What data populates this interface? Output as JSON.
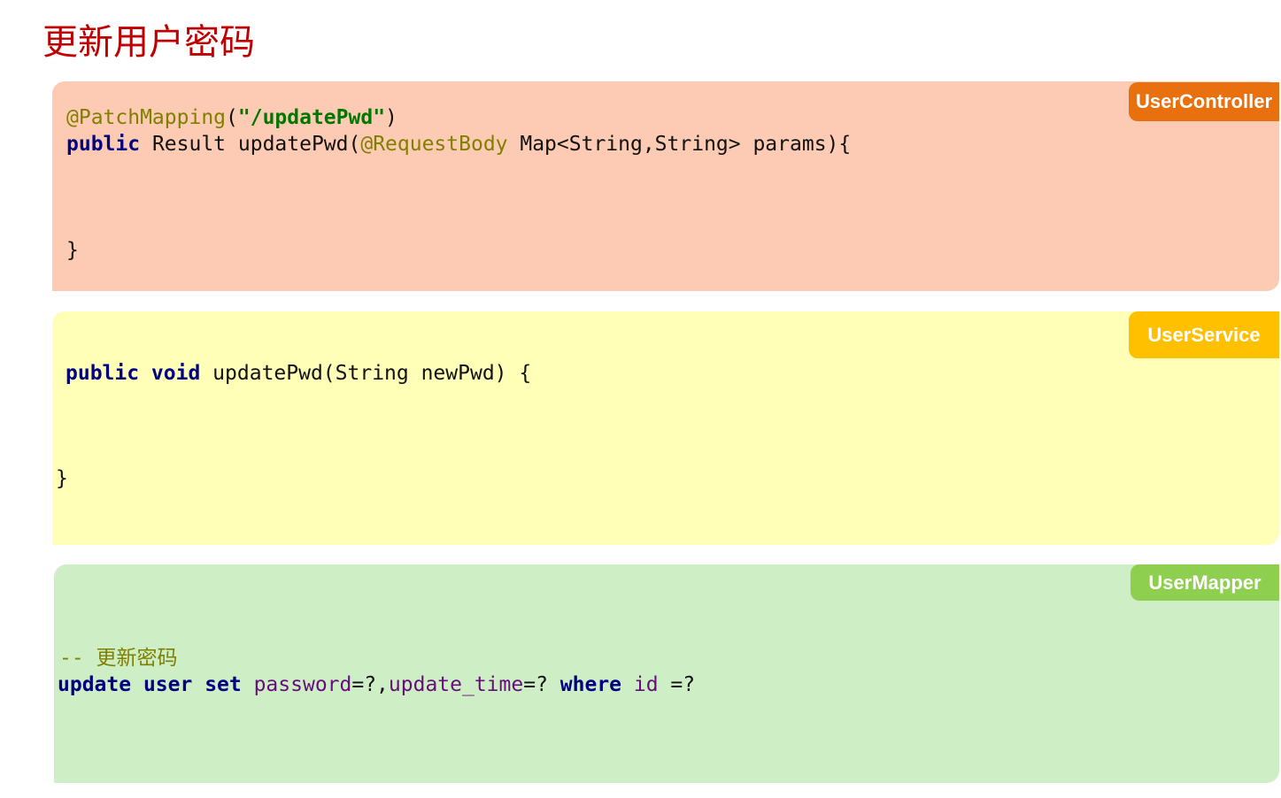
{
  "page": {
    "title": "更新用户密码"
  },
  "colors": {
    "title": "#c00000",
    "controller_bg": "#fdcbb3",
    "controller_tag": "#e8700f",
    "service_bg": "#ffffb7",
    "service_tag": "#ffc000",
    "mapper_bg": "#ceeec6",
    "mapper_tag": "#8fcf4f",
    "keyword": "#000080",
    "annotation": "#808000",
    "string": "#007800",
    "column": "#660e7a"
  },
  "controller": {
    "tag": "UserController",
    "line1_annotation": "@PatchMapping",
    "line1_open": "(",
    "line1_string": "\"/updatePwd\"",
    "line1_close": ")",
    "line2_keyword": "public",
    "line2_sig": " Result updatePwd(",
    "line2_annotation": "@RequestBody",
    "line2_rest": " Map<String,String> params){",
    "closing": "}"
  },
  "service": {
    "tag": "UserService",
    "line1_keyword": "public void",
    "line1_rest": " updatePwd(String newPwd) {",
    "closing": "}"
  },
  "mapper": {
    "tag": "UserMapper",
    "comment": "-- 更新密码",
    "kw_update": "update",
    "kw_user": " user",
    "kw_set": " set",
    "col_password": " password",
    "op1": "=?,",
    "col_update_time": "update_time",
    "op2": "=?",
    "kw_where": " where",
    "col_id": " id",
    "op3": " =?"
  }
}
